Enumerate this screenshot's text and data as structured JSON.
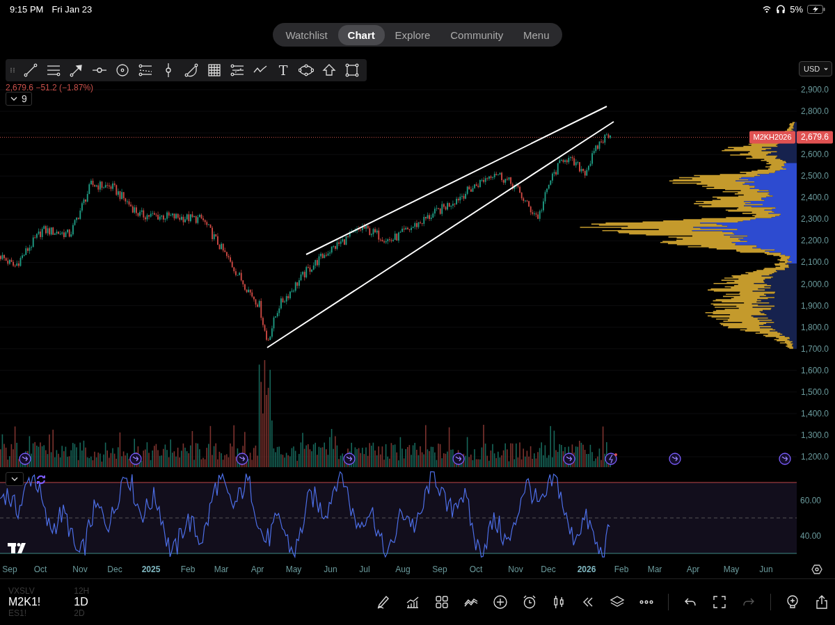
{
  "status_bar": {
    "time": "9:15 PM",
    "date": "Fri Jan 23",
    "battery": "5%"
  },
  "tabs": [
    {
      "label": "Watchlist",
      "selected": false
    },
    {
      "label": "Chart",
      "selected": true
    },
    {
      "label": "Explore",
      "selected": false
    },
    {
      "label": "Community",
      "selected": false
    },
    {
      "label": "Menu",
      "selected": false
    }
  ],
  "drawing_toolbar": {
    "text_tool": "T"
  },
  "legend": {
    "price_change": "2,679.6 −51.2 (−1.87%)",
    "indicator_count": "9"
  },
  "price_axis": {
    "currency": "USD",
    "ticks_upper": [
      "2,900.0",
      "2,800.0"
    ],
    "ticks_lower": [
      "2,600.0",
      "2,500.0",
      "2,400.0",
      "2,300.0",
      "2,200.0",
      "2,100.0",
      "2,000.0",
      "1,900.0",
      "1,800.0",
      "1,700.0",
      "1,600.0",
      "1,500.0",
      "1,400.0",
      "1,300.0",
      "1,200.0"
    ],
    "last_symbol": "M2KH2026",
    "last_price": "2,679.6"
  },
  "rsi_axis": {
    "ticks": [
      "60.00",
      "40.00"
    ]
  },
  "time_axis": [
    {
      "label": "Sep",
      "kind": "month"
    },
    {
      "label": "Oct",
      "kind": "month"
    },
    {
      "label": "Nov",
      "kind": "month"
    },
    {
      "label": "Dec",
      "kind": "month"
    },
    {
      "label": "2025",
      "kind": "year"
    },
    {
      "label": "Feb",
      "kind": "month"
    },
    {
      "label": "Mar",
      "kind": "month"
    },
    {
      "label": "Apr",
      "kind": "month"
    },
    {
      "label": "May",
      "kind": "month"
    },
    {
      "label": "Jun",
      "kind": "month"
    },
    {
      "label": "Jul",
      "kind": "month"
    },
    {
      "label": "Aug",
      "kind": "month"
    },
    {
      "label": "Sep",
      "kind": "month"
    },
    {
      "label": "Oct",
      "kind": "month"
    },
    {
      "label": "Nov",
      "kind": "month"
    },
    {
      "label": "Dec",
      "kind": "month"
    },
    {
      "label": "2026",
      "kind": "year"
    },
    {
      "label": "Feb",
      "kind": "month"
    },
    {
      "label": "Mar",
      "kind": "month"
    },
    {
      "label": "Apr",
      "kind": "month"
    },
    {
      "label": "May",
      "kind": "month"
    },
    {
      "label": "Jun",
      "kind": "month"
    }
  ],
  "symbols": [
    {
      "label": "VXSLV",
      "selected": false
    },
    {
      "label": "M2K1!",
      "selected": true
    },
    {
      "label": "ES1!",
      "selected": false
    }
  ],
  "intervals": [
    {
      "label": "12H",
      "selected": false
    },
    {
      "label": "1D",
      "selected": true
    },
    {
      "label": "2D",
      "selected": false
    }
  ],
  "bottom_toolbar": {
    "redo": {
      "disabled": true
    }
  }
}
